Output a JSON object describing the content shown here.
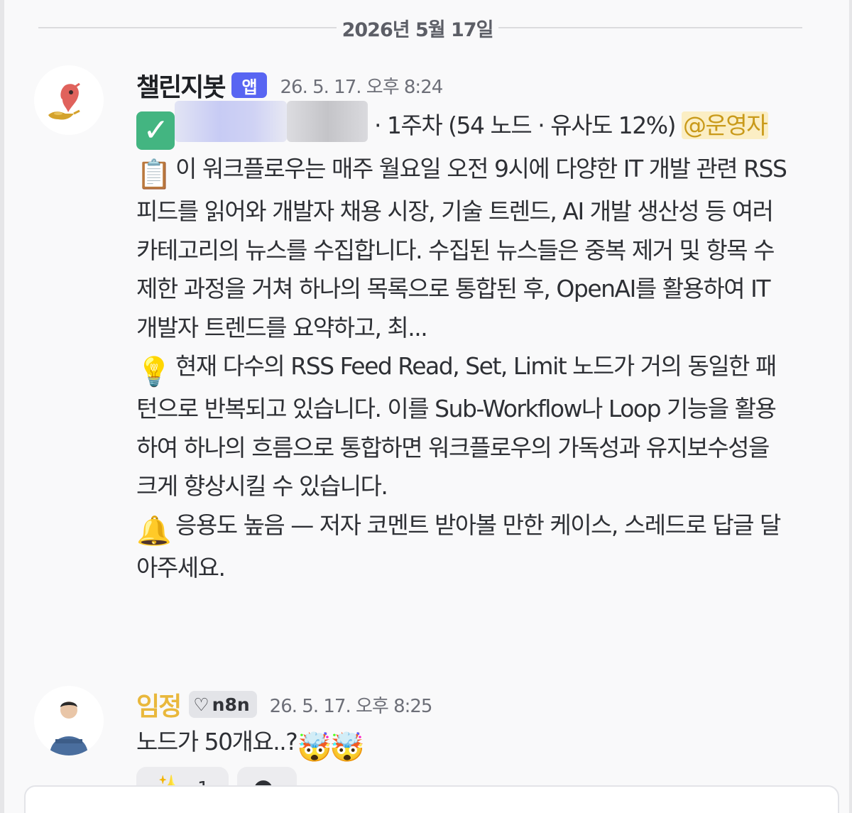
{
  "date_divider": "2026년 5월 17일",
  "message1": {
    "username": "챌린지봇",
    "badge": "앱",
    "timestamp": "26. 5. 17. 오후 8:24",
    "check_emoji": "✓",
    "line1_rest": "· 1주차 (54 노드 · 유사도 12%)",
    "mention": "@운영자",
    "clipboard_emoji": "📋",
    "summary": "이 워크플로우는 매주 월요일 오전 9시에 다양한 IT 개발 관련 RSS 피드를 읽어와 개발자 채용 시장, 기술 트렌드, AI 개발 생산성 등 여러 카테고리의 뉴스를 수집합니다. 수집된 뉴스들은 중복 제거 및 항목 수 제한 과정을 거쳐 하나의 목록으로 통합된 후, OpenAI를 활용하여 IT 개발자 트렌드를 요약하고, 최...",
    "bulb_emoji": "💡",
    "tip": "현재 다수의 RSS Feed Read, Set, Limit 노드가 거의 동일한 패턴으로 반복되고 있습니다. 이를 Sub-Workflow나 Loop 기능을 활용하여 하나의 흐름으로 통합하면 워크플로우의 가독성과 유지보수성을 크게 향상시킬 수 있습니다.",
    "bell_emoji": "🔔",
    "notice": "응용도 높음 — 저자 코멘트 받아볼 만한 케이스, 스레드로 답글 달아주세요."
  },
  "message2": {
    "username": "임정",
    "role_badge": "n8n",
    "role_heart": "♡",
    "timestamp": "26. 5. 17. 오후 8:25",
    "text": "노드가 50개요..?",
    "emoji_1": "🤯",
    "emoji_2": "🤯",
    "reactions": [
      {
        "glyph": "✨",
        "count": "1"
      },
      {
        "glyph": "●",
        "count": ""
      }
    ]
  },
  "colors": {
    "app_badge": "#5865f2",
    "mention_bg": "#fbeec4",
    "mention_text": "#c99a1a",
    "username2": "#e9b83c",
    "check": "#43b581"
  }
}
